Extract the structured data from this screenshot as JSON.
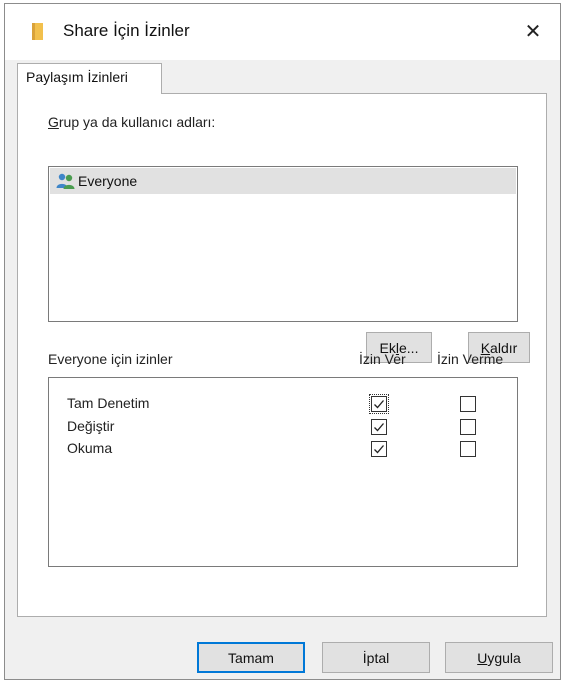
{
  "window": {
    "title": "Share İçin İzinler",
    "close_glyph": "✕"
  },
  "tabs": [
    {
      "label": "Paylaşım İzinleri",
      "active": true
    }
  ],
  "group_section": {
    "label_first": "G",
    "label_rest": "rup ya da kullanıcı adları:",
    "users": [
      {
        "name": "Everyone",
        "selected": true,
        "icon": "users-icon"
      }
    ],
    "add_button": {
      "pre": "Ek",
      "mnemonic": "l",
      "post": "e..."
    },
    "remove_button": {
      "mnemonic": "K",
      "post": "aldır"
    }
  },
  "permissions": {
    "header": "Everyone için izinler",
    "col_allow": "İzin Ver",
    "col_deny": "İzin Verme",
    "rows": [
      {
        "name": "Tam Denetim",
        "allow": true,
        "deny": false
      },
      {
        "name": "Değiştir",
        "allow": true,
        "deny": false
      },
      {
        "name": "Okuma",
        "allow": true,
        "deny": false
      }
    ]
  },
  "footer": {
    "ok": "Tamam",
    "cancel": "İptal",
    "apply_mnemonic": "U",
    "apply_rest": "ygula"
  },
  "colors": {
    "accent": "#0078d7",
    "folder": "#f2c04d",
    "users_icon": "#4a9c4f"
  }
}
